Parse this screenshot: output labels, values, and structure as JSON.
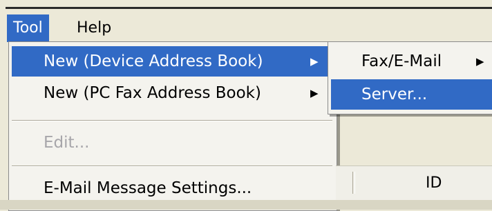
{
  "menubar": {
    "items": [
      {
        "label": "Tool"
      },
      {
        "label": "Help"
      }
    ]
  },
  "tool_menu": {
    "items": [
      {
        "label": "New (Device Address Book)",
        "arrow": "▶"
      },
      {
        "label": "New (PC Fax Address Book)",
        "arrow": "▶"
      },
      {
        "label": "Edit..."
      },
      {
        "label": "E-Mail Message Settings..."
      }
    ]
  },
  "submenu": {
    "items": [
      {
        "label": "Fax/E-Mail",
        "arrow": "▶"
      },
      {
        "label": "Server..."
      }
    ]
  },
  "grid": {
    "column_id": "ID"
  },
  "colors": {
    "highlight": "#316ac5",
    "menu_bg": "#f4f3ee",
    "window_bg": "#ece9d8",
    "disabled_text": "#a7a6aa"
  }
}
